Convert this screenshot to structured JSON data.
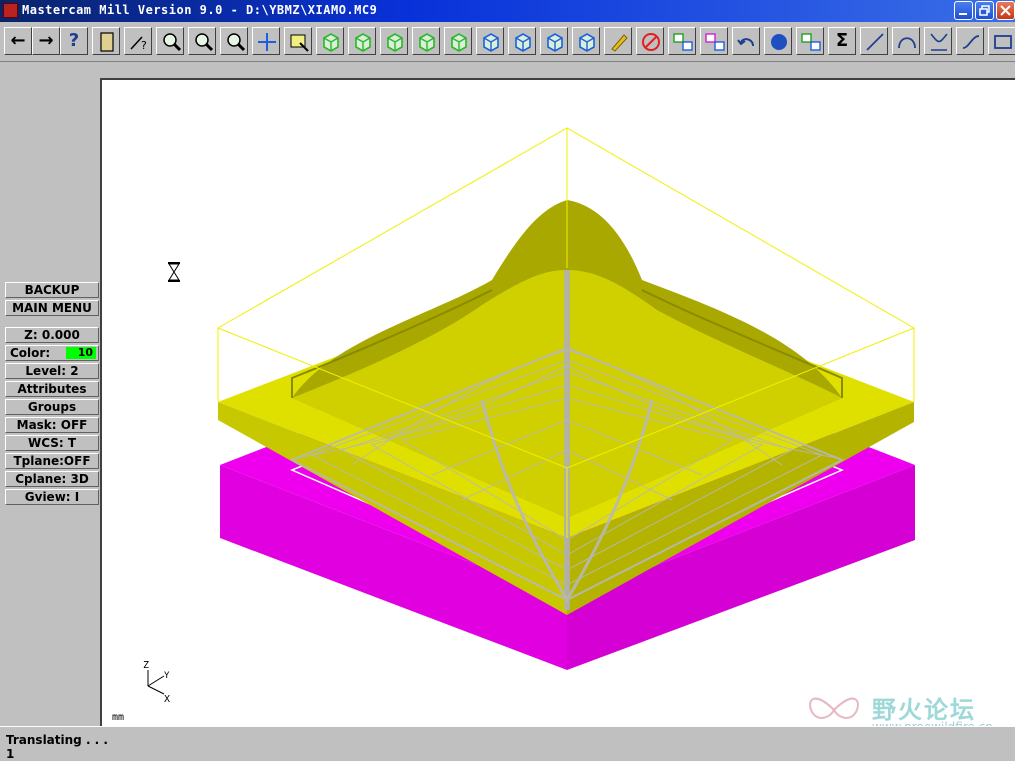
{
  "window": {
    "title": "Mastercam Mill Version 9.0 - D:\\YBMZ\\XIAMO.MC9",
    "minimize_icon": "minimize-icon",
    "maximize_icon": "restore-icon",
    "close_icon": "close-icon"
  },
  "toolbar": {
    "buttons": [
      {
        "name": "back-arrow-button",
        "icon": "arrow-left-icon",
        "glyph": "←"
      },
      {
        "name": "forward-arrow-button",
        "icon": "arrow-right-icon",
        "glyph": "→"
      },
      {
        "name": "help-button",
        "icon": "question-icon",
        "glyph": "?"
      },
      {
        "name": "notebook-button",
        "icon": "notebook-icon"
      },
      {
        "name": "analyze-button",
        "icon": "analyze-cursor-icon"
      },
      {
        "name": "zoom-button",
        "icon": "zoom-icon"
      },
      {
        "name": "unzoom-button",
        "icon": "unzoom-icon"
      },
      {
        "name": "zoom-b-button",
        "icon": "zoom-b-icon"
      },
      {
        "name": "pan-button",
        "icon": "pan-arrows-icon"
      },
      {
        "name": "window-select-button",
        "icon": "window-select-icon"
      },
      {
        "name": "rotate-view-button",
        "icon": "rotate-cube-icon"
      },
      {
        "name": "view-top-button",
        "icon": "green-cube-icon"
      },
      {
        "name": "view-front-button",
        "icon": "green-cube-icon"
      },
      {
        "name": "view-side-button",
        "icon": "green-cube-icon"
      },
      {
        "name": "view-iso-button",
        "icon": "green-cube-icon"
      },
      {
        "name": "cplane-top-button",
        "icon": "blue-cube-icon"
      },
      {
        "name": "cplane-front-button",
        "icon": "blue-cube-icon"
      },
      {
        "name": "cplane-side-button",
        "icon": "blue-cube-icon"
      },
      {
        "name": "cplane-3d-button",
        "icon": "blue-cube-icon"
      },
      {
        "name": "screen-clear-button",
        "icon": "pencil-icon"
      },
      {
        "name": "no-paint-button",
        "icon": "no-entry-icon"
      },
      {
        "name": "transform-button",
        "icon": "transform-icon"
      },
      {
        "name": "transform-color-button",
        "icon": "transform-color-icon"
      },
      {
        "name": "undo-button",
        "icon": "undo-icon"
      },
      {
        "name": "shade-button",
        "icon": "sphere-icon"
      },
      {
        "name": "solid-button",
        "icon": "solid-icon"
      },
      {
        "name": "sum-button",
        "icon": "sigma-icon",
        "glyph": "Σ"
      },
      {
        "name": "line-button",
        "icon": "line-icon"
      },
      {
        "name": "arc-button",
        "icon": "arc-icon"
      },
      {
        "name": "fillet-button",
        "icon": "fillet-icon"
      },
      {
        "name": "spline-button",
        "icon": "spline-icon"
      },
      {
        "name": "rectangle-button",
        "icon": "rectangle-icon"
      }
    ]
  },
  "menu": {
    "backup": "BACKUP",
    "main_menu": "MAIN MENU",
    "z": "Z:  0.000",
    "color_label": "Color:",
    "color_value": "10",
    "color_hex": "#00ff00",
    "level": "Level:  2",
    "attributes": "Attributes",
    "groups": "Groups",
    "mask": "Mask:  OFF",
    "wcs": "WCS:   T",
    "tplane": "Tplane:OFF",
    "cplane": "Cplane: 3D",
    "gview": "Gview:   I"
  },
  "viewport": {
    "units": "mm",
    "axis_z": "Z",
    "axis_y": "Y",
    "axis_x": "X",
    "cursor_icon": "hourglass-icon",
    "colors": {
      "part": "#d4d400",
      "stock": "#ee00ee",
      "wire": "#b8b8b8",
      "box": "#f0f000"
    }
  },
  "watermark": {
    "cn": "野火论坛",
    "url": "www.proewildfire.cn",
    "icon": "butterfly-logo-icon"
  },
  "status": {
    "line1": "Translating . . .",
    "line2": "1"
  }
}
